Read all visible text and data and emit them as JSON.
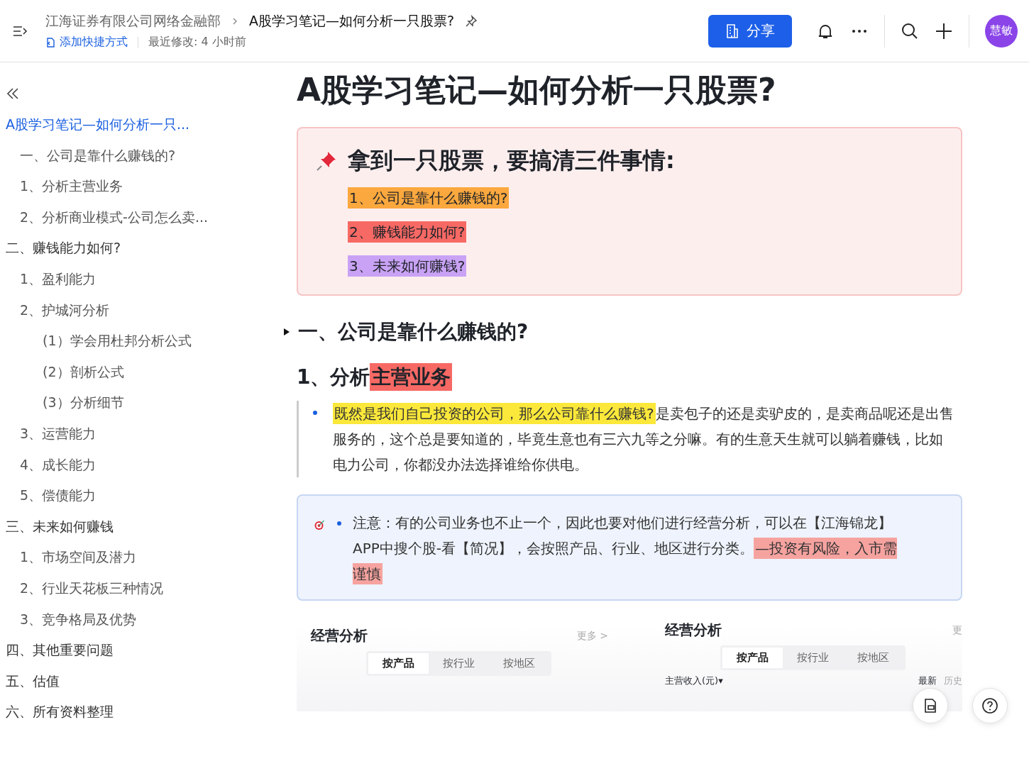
{
  "header": {
    "breadcrumb_parent": "江海证券有限公司网络金融部",
    "doc_title": "A股学习笔记—如何分析一只股票?",
    "add_shortcut": "添加快捷方式",
    "last_modified": "最近修改: 4 小时前",
    "share_button": "分享",
    "avatar": "慧敏"
  },
  "outline": [
    {
      "label": "A股学习笔记—如何分析一只...",
      "selected": true,
      "children": [
        {
          "label": "一、公司是靠什么赚钱的?",
          "selected": false
        },
        {
          "label": "1、分析主营业务",
          "selected": false
        },
        {
          "label": "2、分析商业模式-公司怎么卖...",
          "selected": false
        }
      ]
    },
    {
      "label": "二、赚钱能力如何?",
      "selected": false,
      "children": [
        {
          "label": "1、盈利能力",
          "selected": false
        },
        {
          "label": "2、护城河分析",
          "selected": false,
          "children": [
            {
              "label": "(1）学会用杜邦分析公式",
              "selected": false
            },
            {
              "label": "(2）剖析公式",
              "selected": false
            },
            {
              "label": "(3）分析细节",
              "selected": false
            }
          ]
        },
        {
          "label": "3、运营能力",
          "selected": false
        },
        {
          "label": "4、成长能力",
          "selected": false
        },
        {
          "label": "5、偿债能力",
          "selected": false
        }
      ]
    },
    {
      "label": "三、未来如何赚钱",
      "selected": false,
      "children": [
        {
          "label": "1、市场空间及潜力",
          "selected": false
        },
        {
          "label": "2、行业天花板三种情况",
          "selected": false
        },
        {
          "label": "3、竞争格局及优势",
          "selected": false
        }
      ]
    },
    {
      "label": "四、其他重要问题",
      "selected": false
    },
    {
      "label": "五、估值",
      "selected": false
    },
    {
      "label": "六、所有资料整理",
      "selected": false
    }
  ],
  "document": {
    "title": "A股学习笔记—如何分析一只股票?",
    "callout": {
      "heading": "拿到一只股票，要搞清三件事情:",
      "items": [
        {
          "text": "1、公司是靠什么赚钱的?",
          "color": "#fba83e"
        },
        {
          "text": "2、赚钱能力如何?",
          "color": "#f76964"
        },
        {
          "text": "3、未来如何赚钱?",
          "color": "#c9a2f5"
        }
      ]
    },
    "section_heading": {
      "text": "一、公司是靠什么赚钱的?",
      "expanded": true
    },
    "subheading": [
      {
        "text": "1、分析"
      },
      {
        "text": "主营业务",
        "color": "#f76964"
      }
    ],
    "bullet": [
      {
        "text": "既然是我们自己投资的公司，那么公司靠什么赚钱?",
        "color": "#fbe83a"
      },
      {
        "text": "是卖包子的还是卖驴皮的，是卖商品呢还是出售服务的，这个总是要知道的，毕竟生意也有三六九等之分嘛。有的生意天生就可以躺着赚钱，比如电力公司，你都没办法选择谁给你供电。"
      }
    ],
    "note": [
      {
        "text": "注意：有的公司业务也不止一个，因此也要对他们进行经营分析，可以在【江海锦龙】APP中搜个股-看【简况】，会按照产品、行业、地区进行分类。"
      },
      {
        "text": "—投资有风险，入市需谨慎",
        "color": "#f6a3a0"
      }
    ],
    "embedded_panels": [
      {
        "title": "经营分析",
        "more": "更多 >",
        "tabs": [
          {
            "label": "按产品",
            "selected": true
          },
          {
            "label": "按行业",
            "selected": false
          },
          {
            "label": "按地区",
            "selected": false
          }
        ]
      },
      {
        "title": "经营分析",
        "more": "更",
        "tabs": [
          {
            "label": "按产品",
            "selected": true
          },
          {
            "label": "按行业",
            "selected": false
          },
          {
            "label": "按地区",
            "selected": false
          }
        ],
        "metric": "主营收入(元)▾",
        "toggle": [
          "最新",
          "历史"
        ]
      }
    ]
  }
}
